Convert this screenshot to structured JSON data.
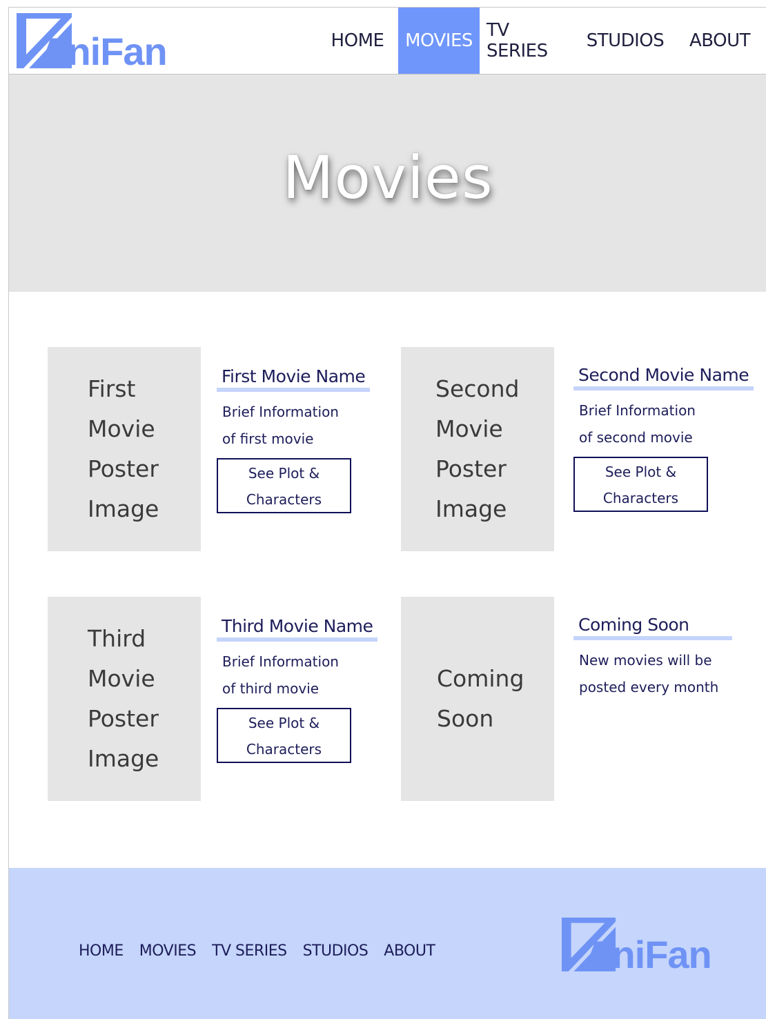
{
  "brand": {
    "name": "AniFan",
    "accent": "#6f96fb",
    "light_accent": "#c5d5fb"
  },
  "nav": {
    "items": [
      {
        "label": "HOME"
      },
      {
        "label": "MOVIES",
        "active": true
      },
      {
        "label": "TV SERIES"
      },
      {
        "label": "STUDIOS"
      },
      {
        "label": "ABOUT"
      }
    ]
  },
  "hero": {
    "title": "Movies"
  },
  "movies": [
    {
      "poster_lines": [
        "First",
        "Movie",
        "Poster",
        "Image"
      ],
      "name": "First Movie Name",
      "brief_lines": [
        "Brief Information",
        "of first movie"
      ],
      "button_lines": [
        "See Plot &",
        "Characters"
      ]
    },
    {
      "poster_lines": [
        "Second",
        "Movie",
        "Poster",
        "Image"
      ],
      "name": "Second Movie Name",
      "brief_lines": [
        "Brief Information",
        "of second movie"
      ],
      "button_lines": [
        "See Plot &",
        "Characters"
      ]
    },
    {
      "poster_lines": [
        "Third",
        "Movie",
        "Poster",
        "Image"
      ],
      "name": "Third Movie Name",
      "brief_lines": [
        "Brief Information",
        "of third movie"
      ],
      "button_lines": [
        "See Plot &",
        "Characters"
      ]
    },
    {
      "poster_lines": [
        "Coming",
        "Soon"
      ],
      "name": "Coming Soon",
      "brief_lines": [
        "New movies will be",
        "posted every month"
      ]
    }
  ],
  "footer": {
    "nav": [
      "HOME",
      "MOVIES",
      "TV SERIES",
      "STUDIOS",
      "ABOUT"
    ],
    "logo_text": "AniFan"
  }
}
